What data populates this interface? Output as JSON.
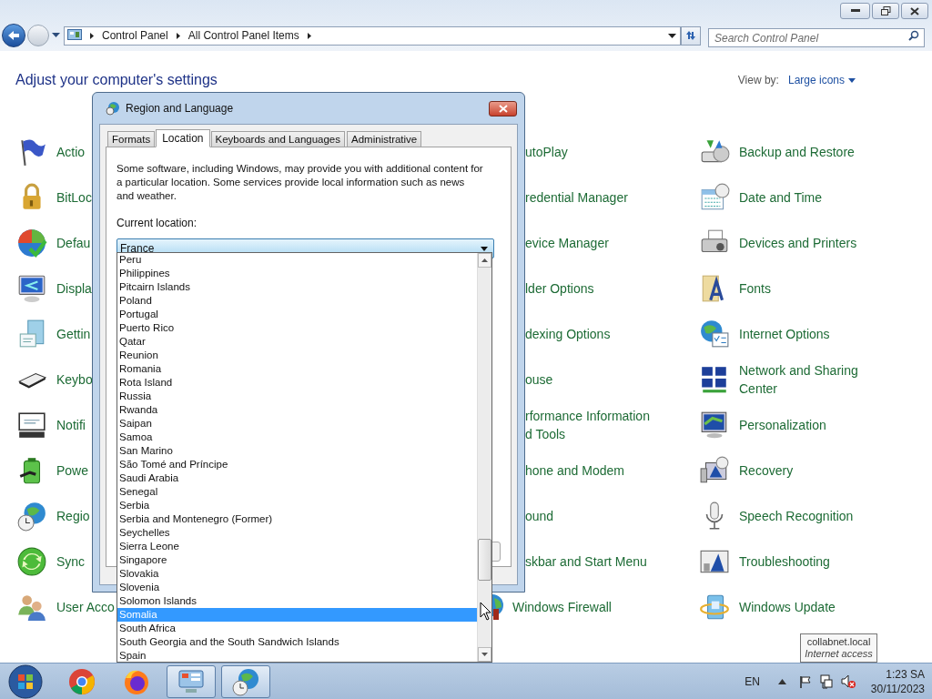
{
  "window": {
    "breadcrumbs": [
      "Control Panel",
      "All Control Panel Items"
    ],
    "search": {
      "placeholder": "Search Control Panel"
    }
  },
  "header": {
    "title": "Adjust your computer's settings",
    "view_by_label": "View by:",
    "view_by_value": "Large icons"
  },
  "columns": [
    {
      "items": [
        {
          "lines": [
            "Actio"
          ]
        },
        {
          "lines": [
            "BitLoc"
          ]
        },
        {
          "lines": [
            "Defau"
          ]
        },
        {
          "lines": [
            "Displa"
          ]
        },
        {
          "lines": [
            "Gettin"
          ]
        },
        {
          "lines": [
            "Keybo"
          ]
        },
        {
          "lines": [
            "Notifi"
          ]
        },
        {
          "lines": [
            "Powe"
          ]
        },
        {
          "lines": [
            "Regio"
          ]
        },
        {
          "lines": [
            "Sync"
          ]
        },
        {
          "lines": [
            "User Acco"
          ]
        }
      ]
    },
    {
      "items": [
        {
          "lines": [
            "utoPlay"
          ]
        },
        {
          "lines": [
            "redential Manager"
          ]
        },
        {
          "lines": [
            "evice Manager"
          ]
        },
        {
          "lines": [
            "lder Options"
          ]
        },
        {
          "lines": [
            "dexing Options"
          ]
        },
        {
          "lines": [
            "ouse"
          ]
        },
        {
          "lines": [
            "rformance Information",
            "d Tools"
          ]
        },
        {
          "lines": [
            "hone and Modem"
          ]
        },
        {
          "lines": [
            "ound"
          ]
        },
        {
          "lines": [
            "skbar and Start Menu"
          ]
        },
        {
          "lines": [
            "Windows Firewall"
          ]
        }
      ]
    },
    {
      "items": [
        {
          "lines": [
            "Backup and Restore"
          ]
        },
        {
          "lines": [
            "Date and Time"
          ]
        },
        {
          "lines": [
            "Devices and Printers"
          ]
        },
        {
          "lines": [
            "Fonts"
          ]
        },
        {
          "lines": [
            "Internet Options"
          ]
        },
        {
          "lines": [
            "Network and Sharing",
            "Center"
          ]
        },
        {
          "lines": [
            "Personalization"
          ]
        },
        {
          "lines": [
            "Recovery"
          ]
        },
        {
          "lines": [
            "Speech Recognition"
          ]
        },
        {
          "lines": [
            "Troubleshooting"
          ]
        },
        {
          "lines": [
            "Windows Update"
          ]
        }
      ]
    }
  ],
  "dialog": {
    "title": "Region and Language",
    "tabs": [
      {
        "label": "Formats",
        "selected": false
      },
      {
        "label": "Location",
        "selected": true
      },
      {
        "label": "Keyboards and Languages",
        "selected": false
      },
      {
        "label": "Administrative",
        "selected": false
      }
    ],
    "description": "Some software, including Windows, may provide you with additional content for a particular location. Some services provide local information such as news and weather.",
    "location_label": "Current location:",
    "location_value": "France",
    "options": [
      {
        "label": "Peru",
        "selected": false
      },
      {
        "label": "Philippines",
        "selected": false
      },
      {
        "label": "Pitcairn Islands",
        "selected": false
      },
      {
        "label": "Poland",
        "selected": false
      },
      {
        "label": "Portugal",
        "selected": false
      },
      {
        "label": "Puerto Rico",
        "selected": false
      },
      {
        "label": "Qatar",
        "selected": false
      },
      {
        "label": "Reunion",
        "selected": false
      },
      {
        "label": "Romania",
        "selected": false
      },
      {
        "label": "Rota Island",
        "selected": false
      },
      {
        "label": "Russia",
        "selected": false
      },
      {
        "label": "Rwanda",
        "selected": false
      },
      {
        "label": "Saipan",
        "selected": false
      },
      {
        "label": "Samoa",
        "selected": false
      },
      {
        "label": "San Marino",
        "selected": false
      },
      {
        "label": "São Tomé and Príncipe",
        "selected": false
      },
      {
        "label": "Saudi Arabia",
        "selected": false
      },
      {
        "label": "Senegal",
        "selected": false
      },
      {
        "label": "Serbia",
        "selected": false
      },
      {
        "label": "Serbia and Montenegro (Former)",
        "selected": false
      },
      {
        "label": "Seychelles",
        "selected": false
      },
      {
        "label": "Sierra Leone",
        "selected": false
      },
      {
        "label": "Singapore",
        "selected": false
      },
      {
        "label": "Slovakia",
        "selected": false
      },
      {
        "label": "Slovenia",
        "selected": false
      },
      {
        "label": "Solomon Islands",
        "selected": false
      },
      {
        "label": "Somalia",
        "selected": true
      },
      {
        "label": "South Africa",
        "selected": false
      },
      {
        "label": "South Georgia and the South Sandwich Islands",
        "selected": false
      },
      {
        "label": "Spain",
        "selected": false
      }
    ]
  },
  "taskbar": {
    "apps": [
      {
        "active": false
      },
      {
        "active": false
      },
      {
        "active": true
      },
      {
        "active": true
      }
    ],
    "language": "EN",
    "time": "1:23 SA",
    "date": "30/11/2023"
  },
  "tooltip": {
    "title": "collabnet.local",
    "subtitle": "Internet access"
  }
}
